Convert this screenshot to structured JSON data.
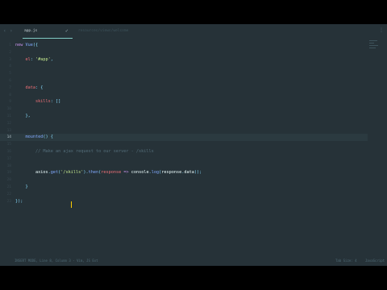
{
  "tabs": [
    {
      "label": "app.js",
      "active": true
    },
    {
      "label": "resources/views/welcome",
      "active": false
    }
  ],
  "icons": {
    "nav_left": "‹",
    "nav_right": "›",
    "close": "✓",
    "more": "⋮"
  },
  "code": {
    "lines": [
      {
        "num": "1",
        "parts": [
          {
            "t": "new ",
            "c": "kw"
          },
          {
            "t": "Vue",
            "c": "fn"
          },
          {
            "t": "({",
            "c": "punc"
          }
        ]
      },
      {
        "num": "2",
        "parts": []
      },
      {
        "num": "3",
        "parts": [
          {
            "t": "    el",
            "c": "prop"
          },
          {
            "t": ": ",
            "c": "punc"
          },
          {
            "t": "'#app'",
            "c": "str"
          },
          {
            "t": ",",
            "c": "punc"
          }
        ]
      },
      {
        "num": "4",
        "parts": []
      },
      {
        "num": "5",
        "parts": []
      },
      {
        "num": "6",
        "parts": []
      },
      {
        "num": "7",
        "parts": [
          {
            "t": "    data",
            "c": "prop"
          },
          {
            "t": ": {",
            "c": "punc"
          }
        ]
      },
      {
        "num": "8",
        "parts": []
      },
      {
        "num": "9",
        "parts": [
          {
            "t": "        skills",
            "c": "prop"
          },
          {
            "t": ": []",
            "c": "punc"
          }
        ]
      },
      {
        "num": "10",
        "parts": []
      },
      {
        "num": "11",
        "parts": [
          {
            "t": "    },",
            "c": "punc"
          }
        ]
      },
      {
        "num": "12",
        "parts": []
      },
      {
        "num": "13",
        "parts": []
      },
      {
        "num": "14",
        "parts": [
          {
            "t": "    mounted",
            "c": "fn"
          },
          {
            "t": "() {",
            "c": "punc"
          }
        ],
        "current": true
      },
      {
        "num": "15",
        "parts": []
      },
      {
        "num": "16",
        "parts": [
          {
            "t": "        // Make an ajax request to our server - /skills",
            "c": "cmt"
          }
        ]
      },
      {
        "num": "17",
        "parts": []
      },
      {
        "num": "18",
        "parts": []
      },
      {
        "num": "19",
        "parts": [
          {
            "t": "        axios",
            "c": "plain"
          },
          {
            "t": ".",
            "c": "punc"
          },
          {
            "t": "get",
            "c": "fn"
          },
          {
            "t": "(",
            "c": "punc"
          },
          {
            "t": "'/skills'",
            "c": "str"
          },
          {
            "t": ").",
            "c": "punc"
          },
          {
            "t": "then",
            "c": "fn"
          },
          {
            "t": "(",
            "c": "punc"
          },
          {
            "t": "response",
            "c": "prop"
          },
          {
            "t": " => ",
            "c": "kw"
          },
          {
            "t": "console",
            "c": "plain"
          },
          {
            "t": ".",
            "c": "punc"
          },
          {
            "t": "log",
            "c": "fn"
          },
          {
            "t": "(",
            "c": "punc"
          },
          {
            "t": "response",
            "c": "plain"
          },
          {
            "t": ".",
            "c": "punc"
          },
          {
            "t": "data",
            "c": "plain"
          },
          {
            "t": "));",
            "c": "punc"
          }
        ]
      },
      {
        "num": "20",
        "parts": []
      },
      {
        "num": "21",
        "parts": [
          {
            "t": "    }",
            "c": "punc"
          }
        ]
      },
      {
        "num": "22",
        "parts": []
      },
      {
        "num": "23",
        "parts": [
          {
            "t": "});",
            "c": "punc"
          }
        ]
      }
    ]
  },
  "status": {
    "left": "INSERT MODE, Line 8, Column 3 - Vim, JS Ext",
    "tab_size": "Tab Size: 4",
    "syntax": "JavaScript"
  }
}
